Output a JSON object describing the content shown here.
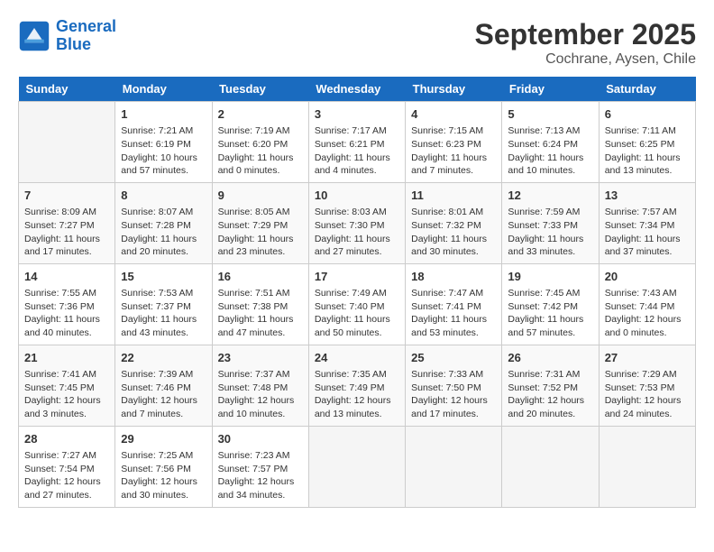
{
  "header": {
    "logo_line1": "General",
    "logo_line2": "Blue",
    "month": "September 2025",
    "location": "Cochrane, Aysen, Chile"
  },
  "weekdays": [
    "Sunday",
    "Monday",
    "Tuesday",
    "Wednesday",
    "Thursday",
    "Friday",
    "Saturday"
  ],
  "weeks": [
    [
      {
        "day": "",
        "info": ""
      },
      {
        "day": "1",
        "info": "Sunrise: 7:21 AM\nSunset: 6:19 PM\nDaylight: 10 hours\nand 57 minutes."
      },
      {
        "day": "2",
        "info": "Sunrise: 7:19 AM\nSunset: 6:20 PM\nDaylight: 11 hours\nand 0 minutes."
      },
      {
        "day": "3",
        "info": "Sunrise: 7:17 AM\nSunset: 6:21 PM\nDaylight: 11 hours\nand 4 minutes."
      },
      {
        "day": "4",
        "info": "Sunrise: 7:15 AM\nSunset: 6:23 PM\nDaylight: 11 hours\nand 7 minutes."
      },
      {
        "day": "5",
        "info": "Sunrise: 7:13 AM\nSunset: 6:24 PM\nDaylight: 11 hours\nand 10 minutes."
      },
      {
        "day": "6",
        "info": "Sunrise: 7:11 AM\nSunset: 6:25 PM\nDaylight: 11 hours\nand 13 minutes."
      }
    ],
    [
      {
        "day": "7",
        "info": "Sunrise: 8:09 AM\nSunset: 7:27 PM\nDaylight: 11 hours\nand 17 minutes."
      },
      {
        "day": "8",
        "info": "Sunrise: 8:07 AM\nSunset: 7:28 PM\nDaylight: 11 hours\nand 20 minutes."
      },
      {
        "day": "9",
        "info": "Sunrise: 8:05 AM\nSunset: 7:29 PM\nDaylight: 11 hours\nand 23 minutes."
      },
      {
        "day": "10",
        "info": "Sunrise: 8:03 AM\nSunset: 7:30 PM\nDaylight: 11 hours\nand 27 minutes."
      },
      {
        "day": "11",
        "info": "Sunrise: 8:01 AM\nSunset: 7:32 PM\nDaylight: 11 hours\nand 30 minutes."
      },
      {
        "day": "12",
        "info": "Sunrise: 7:59 AM\nSunset: 7:33 PM\nDaylight: 11 hours\nand 33 minutes."
      },
      {
        "day": "13",
        "info": "Sunrise: 7:57 AM\nSunset: 7:34 PM\nDaylight: 11 hours\nand 37 minutes."
      }
    ],
    [
      {
        "day": "14",
        "info": "Sunrise: 7:55 AM\nSunset: 7:36 PM\nDaylight: 11 hours\nand 40 minutes."
      },
      {
        "day": "15",
        "info": "Sunrise: 7:53 AM\nSunset: 7:37 PM\nDaylight: 11 hours\nand 43 minutes."
      },
      {
        "day": "16",
        "info": "Sunrise: 7:51 AM\nSunset: 7:38 PM\nDaylight: 11 hours\nand 47 minutes."
      },
      {
        "day": "17",
        "info": "Sunrise: 7:49 AM\nSunset: 7:40 PM\nDaylight: 11 hours\nand 50 minutes."
      },
      {
        "day": "18",
        "info": "Sunrise: 7:47 AM\nSunset: 7:41 PM\nDaylight: 11 hours\nand 53 minutes."
      },
      {
        "day": "19",
        "info": "Sunrise: 7:45 AM\nSunset: 7:42 PM\nDaylight: 11 hours\nand 57 minutes."
      },
      {
        "day": "20",
        "info": "Sunrise: 7:43 AM\nSunset: 7:44 PM\nDaylight: 12 hours\nand 0 minutes."
      }
    ],
    [
      {
        "day": "21",
        "info": "Sunrise: 7:41 AM\nSunset: 7:45 PM\nDaylight: 12 hours\nand 3 minutes."
      },
      {
        "day": "22",
        "info": "Sunrise: 7:39 AM\nSunset: 7:46 PM\nDaylight: 12 hours\nand 7 minutes."
      },
      {
        "day": "23",
        "info": "Sunrise: 7:37 AM\nSunset: 7:48 PM\nDaylight: 12 hours\nand 10 minutes."
      },
      {
        "day": "24",
        "info": "Sunrise: 7:35 AM\nSunset: 7:49 PM\nDaylight: 12 hours\nand 13 minutes."
      },
      {
        "day": "25",
        "info": "Sunrise: 7:33 AM\nSunset: 7:50 PM\nDaylight: 12 hours\nand 17 minutes."
      },
      {
        "day": "26",
        "info": "Sunrise: 7:31 AM\nSunset: 7:52 PM\nDaylight: 12 hours\nand 20 minutes."
      },
      {
        "day": "27",
        "info": "Sunrise: 7:29 AM\nSunset: 7:53 PM\nDaylight: 12 hours\nand 24 minutes."
      }
    ],
    [
      {
        "day": "28",
        "info": "Sunrise: 7:27 AM\nSunset: 7:54 PM\nDaylight: 12 hours\nand 27 minutes."
      },
      {
        "day": "29",
        "info": "Sunrise: 7:25 AM\nSunset: 7:56 PM\nDaylight: 12 hours\nand 30 minutes."
      },
      {
        "day": "30",
        "info": "Sunrise: 7:23 AM\nSunset: 7:57 PM\nDaylight: 12 hours\nand 34 minutes."
      },
      {
        "day": "",
        "info": ""
      },
      {
        "day": "",
        "info": ""
      },
      {
        "day": "",
        "info": ""
      },
      {
        "day": "",
        "info": ""
      }
    ]
  ]
}
